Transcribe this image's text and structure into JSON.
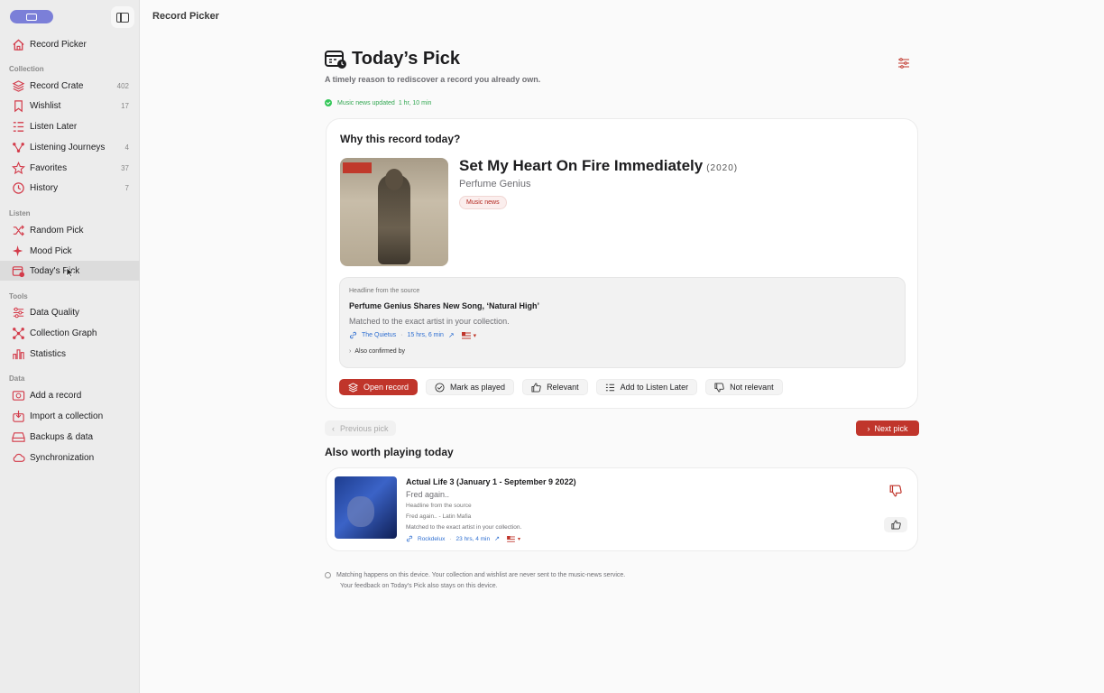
{
  "window": {
    "title": "Record Picker"
  },
  "sidebar": {
    "home": {
      "label": "Record Picker"
    },
    "sections": [
      {
        "title": "Collection"
      },
      {
        "title": "Listen"
      },
      {
        "title": "Tools"
      },
      {
        "title": "Data"
      }
    ],
    "collection": [
      {
        "label": "Record Crate",
        "count": "402",
        "icon": "layers-icon"
      },
      {
        "label": "Wishlist",
        "count": "17",
        "icon": "bookmark-icon"
      },
      {
        "label": "Listen Later",
        "count": "",
        "icon": "list-icon"
      },
      {
        "label": "Listening Journeys",
        "count": "4",
        "icon": "journey-icon"
      },
      {
        "label": "Favorites",
        "count": "37",
        "icon": "star-icon"
      },
      {
        "label": "History",
        "count": "7",
        "icon": "history-icon"
      }
    ],
    "listen": [
      {
        "label": "Random Pick",
        "icon": "shuffle-icon"
      },
      {
        "label": "Mood Pick",
        "icon": "sparkle-icon"
      },
      {
        "label": "Today's Pick",
        "icon": "calendar-icon",
        "active": true
      }
    ],
    "tools": [
      {
        "label": "Data Quality",
        "icon": "sliders-icon"
      },
      {
        "label": "Collection Graph",
        "icon": "graph-icon"
      },
      {
        "label": "Statistics",
        "icon": "chart-icon"
      }
    ],
    "data": [
      {
        "label": "Add a record",
        "icon": "add-record-icon"
      },
      {
        "label": "Import a collection",
        "icon": "import-icon"
      },
      {
        "label": "Backups & data",
        "icon": "drive-icon"
      },
      {
        "label": "Synchronization",
        "icon": "cloud-icon"
      }
    ]
  },
  "page": {
    "title": "Today’s Pick",
    "subtitle": "A timely reason to rediscover a record you already own.",
    "status": {
      "text": "Music news updated",
      "time": "1 hr, 10 min"
    }
  },
  "main_card": {
    "heading": "Why this record today?",
    "record": {
      "title": "Set My Heart On Fire Immediately",
      "year": "(2020)",
      "artist": "Perfume Genius",
      "badge": "Music news"
    },
    "source": {
      "label": "Headline from the source",
      "headline": "Perfume Genius Shares New Song, ‘Natural High’",
      "match": "Matched to the exact artist in your collection.",
      "publisher": "The Quietus",
      "age": "15 hrs, 6 min",
      "confirmed": "Also confirmed by"
    },
    "actions": {
      "open": "Open record",
      "played": "Mark as played",
      "relevant": "Relevant",
      "listen_later": "Add to Listen Later",
      "not_relevant": "Not relevant"
    }
  },
  "pager": {
    "previous": "Previous pick",
    "next": "Next pick"
  },
  "also": {
    "title": "Also worth playing today",
    "item": {
      "title": "Actual Life 3 (January 1 - September 9 2022)",
      "artist": "Fred again..",
      "source_label": "Headline from the source",
      "headline": "Fred again.. - Latin Mafia",
      "match": "Matched to the exact artist in your collection.",
      "publisher": "Rockdelux",
      "age": "23 hrs, 4 min"
    }
  },
  "footer": {
    "line1": "Matching happens on this device. Your collection and wishlist are never sent to the music-news service.",
    "line2": "Your feedback on Today’s Pick also stays on this device."
  },
  "colors": {
    "accent": "#c0352b",
    "link": "#2f6fd1",
    "success": "#34c759",
    "sidebar_bg": "#ececec"
  }
}
